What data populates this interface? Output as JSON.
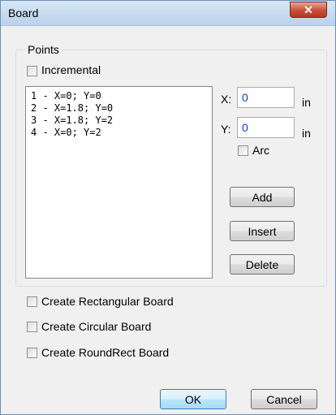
{
  "window": {
    "title": "Board",
    "close_glyph": "✕"
  },
  "points": {
    "group_label": "Points",
    "incremental_label": "Incremental",
    "incremental_checked": false,
    "items": [
      "1 - X=0; Y=0",
      "2 - X=1.8; Y=0",
      "3 - X=1.8; Y=2",
      "4 - X=0; Y=2"
    ],
    "x_label": "X:",
    "x_value": "0",
    "x_unit": "in",
    "y_label": "Y:",
    "y_value": "0",
    "y_unit": "in",
    "arc_label": "Arc",
    "arc_checked": false,
    "add_label": "Add",
    "insert_label": "Insert",
    "delete_label": "Delete"
  },
  "options": {
    "rect_label": "Create Rectangular Board",
    "circular_label": "Create Circular Board",
    "roundrect_label": "Create RoundRect Board"
  },
  "footer": {
    "ok_label": "OK",
    "cancel_label": "Cancel"
  }
}
